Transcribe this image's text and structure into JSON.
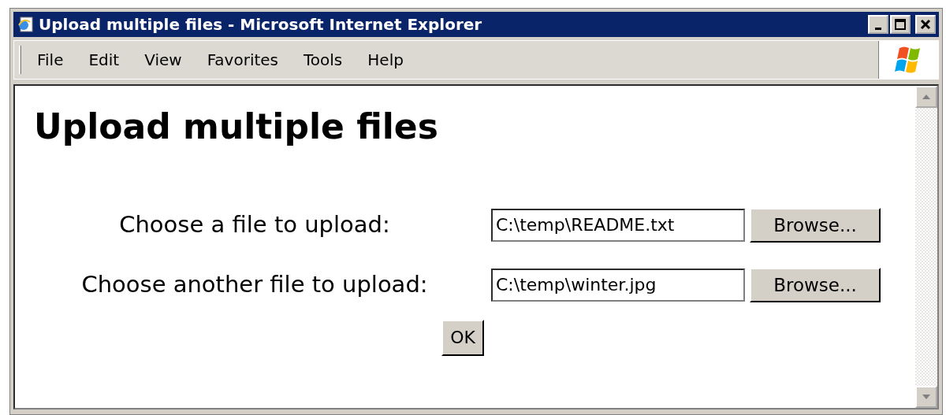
{
  "window": {
    "title": "Upload multiple files - Microsoft Internet Explorer"
  },
  "menu": [
    "File",
    "Edit",
    "View",
    "Favorites",
    "Tools",
    "Help"
  ],
  "page": {
    "heading": "Upload multiple files",
    "fields": [
      {
        "label": "Choose a file to upload:",
        "value": "C:\\temp\\README.txt",
        "button": "Browse..."
      },
      {
        "label": "Choose another file to upload:",
        "value": "C:\\temp\\winter.jpg",
        "button": "Browse..."
      }
    ],
    "submit": "OK"
  }
}
